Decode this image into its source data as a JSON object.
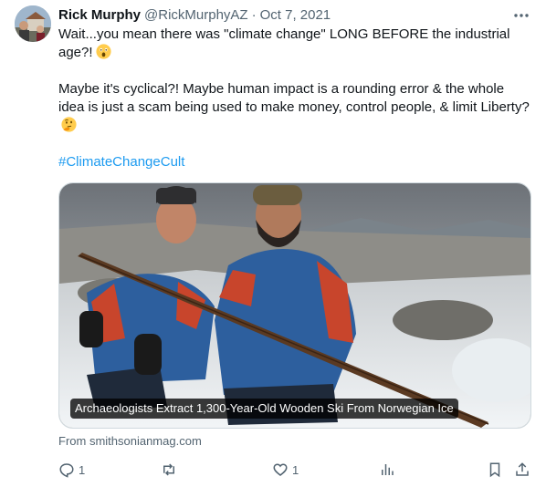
{
  "tweet": {
    "display_name": "Rick Murphy",
    "handle": "@RickMurphyAZ",
    "separator": "·",
    "date": "Oct 7, 2021",
    "paragraphs": [
      "Wait...you mean there was \"climate change\" LONG BEFORE the industrial age?!",
      "Maybe it's cyclical?! Maybe human impact is a rounding error & the whole idea is just a scam being used to make money, control people, & limit Liberty?",
      "#ClimateChangeCult"
    ],
    "emojis": [
      "astonished-face",
      "thinking-face"
    ]
  },
  "card": {
    "caption": "Archaeologists Extract 1,300-Year-Old Wooden Ski From Norwegian Ice",
    "source": "From smithsonianmag.com"
  },
  "actions": {
    "reply_count": "1",
    "like_count": "1",
    "icons": [
      "reply-icon",
      "retweet-icon",
      "like-icon",
      "views-icon",
      "bookmark-icon",
      "share-icon"
    ]
  },
  "colors": {
    "text": "#0f1419",
    "secondary": "#536471",
    "link": "#1d9bf0",
    "border": "#cfd9de"
  }
}
